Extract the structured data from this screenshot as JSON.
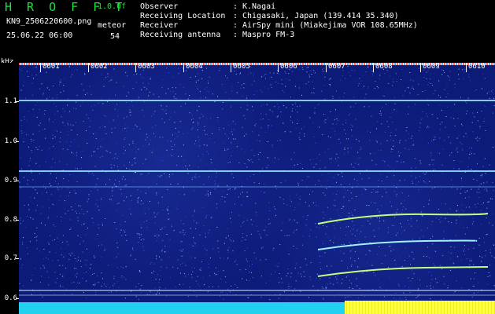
{
  "header": {
    "app_title": "H R O F F T",
    "app_version": "1.0.0f",
    "file_name": "KN9_2506220600.png",
    "datetime": "25.06.22 06:00",
    "meteor_label": "meteor",
    "meteor_count": "54",
    "info": [
      {
        "label": "Observer",
        "value": "K.Nagai"
      },
      {
        "label": "Receiving Location",
        "value": "Chigasaki, Japan (139.414 35.340)"
      },
      {
        "label": "Receiver",
        "value": "AirSpy mini (Miakejima VOR 108.65MHz)"
      },
      {
        "label": "Receiving antenna",
        "value": "Maspro FM-3"
      }
    ]
  },
  "axis": {
    "unit": "kHz",
    "y_labels": [
      "1.1",
      "1.0",
      "0.9",
      "0.8",
      "0.7",
      "0.6"
    ],
    "time_labels": [
      "0601",
      "0602",
      "0603",
      "0604",
      "0605",
      "0606",
      "0607",
      "0608",
      "0609",
      "0610"
    ]
  },
  "colors": {
    "background": "#0c1a78",
    "signal_line": "#8fe0ff",
    "echo": "#c0ff80",
    "accent_green": "#20e040",
    "level_bar": "#22d0f0",
    "level_bar_hot": "#ffff40"
  }
}
